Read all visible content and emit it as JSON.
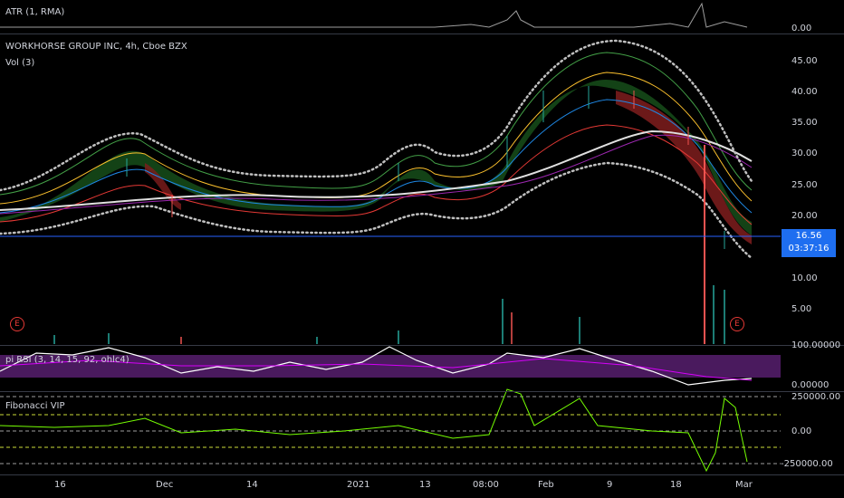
{
  "atr_pane": {
    "label": "ATR (1, RMA)",
    "ticks": [
      "0.00"
    ]
  },
  "main_pane": {
    "title": "WORKHORSE GROUP INC, 4h, Cboe BZX",
    "volume_label": "Vol (3)",
    "ticks": [
      "45.00",
      "40.00",
      "35.00",
      "30.00",
      "25.00",
      "20.00",
      "10.00",
      "5.00"
    ],
    "last_price": "16.56",
    "countdown": "03:37:16",
    "earnings_badge": "E"
  },
  "rsi_pane": {
    "label": "pi RSI (3, 14, 15, 92, ohlc4)",
    "ticks": [
      "100.00000",
      "0.00000"
    ]
  },
  "fib_pane": {
    "label": "Fibonacci VIP",
    "ticks": [
      "250000.00",
      "0.00",
      "-250000.00"
    ]
  },
  "time_axis": [
    "16",
    "Dec",
    "14",
    "2021",
    "13",
    "08:00",
    "Feb",
    "9",
    "18",
    "Mar"
  ],
  "colors": {
    "up": "#26a69a",
    "down": "#ef5350",
    "bands_dots": "#c0c0c0",
    "rsi_bg": "#4a1a5e",
    "price_line": "#2962ff"
  }
}
